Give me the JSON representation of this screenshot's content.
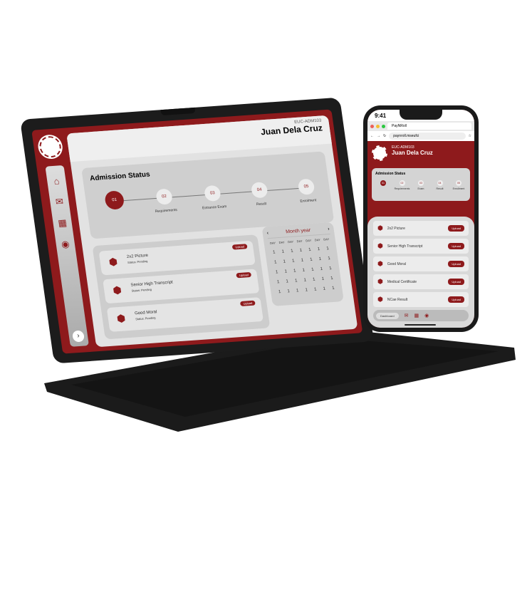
{
  "laptop": {
    "header": {
      "id": "EUC-ADM103",
      "name": "Juan Dela Cruz"
    },
    "sidebar": {
      "icons": [
        "home-icon",
        "mail-icon",
        "calendar-icon",
        "user-icon"
      ],
      "expand": "›"
    },
    "status": {
      "title": "Admission Status",
      "steps": [
        {
          "num": "01",
          "label": ""
        },
        {
          "num": "02",
          "label": "Requirements"
        },
        {
          "num": "03",
          "label": "Entrance Exam"
        },
        {
          "num": "04",
          "label": "Result"
        },
        {
          "num": "05",
          "label": "Enrolment"
        }
      ]
    },
    "documents": [
      {
        "title": "2x2 Picture",
        "status": "Status: Pending",
        "action": "Upload"
      },
      {
        "title": "Senior High Transcript",
        "status": "Status: Pending",
        "action": "Upload"
      },
      {
        "title": "Good Moral",
        "status": "Status: Pending",
        "action": "Upload"
      }
    ],
    "calendar": {
      "title": "Month year",
      "prev": "‹",
      "next": "›",
      "days": [
        "DAY",
        "DAY",
        "DAY",
        "DAY",
        "DAY",
        "DAY",
        "DAY"
      ],
      "dates": [
        "1",
        "1",
        "1",
        "1",
        "1",
        "1",
        "1",
        "1",
        "1",
        "1",
        "1",
        "1",
        "1",
        "1",
        "1",
        "1",
        "1",
        "1",
        "1",
        "1",
        "1",
        "1",
        "1",
        "1",
        "1",
        "1",
        "1",
        "1",
        "1",
        "1",
        "1",
        "1",
        "1",
        "1",
        "1"
      ]
    }
  },
  "phone": {
    "time": "9:41",
    "tab": "PayNRoll",
    "url": "paynroll.mseufci",
    "header": {
      "id": "EUC-ADM103",
      "name": "Juan Dela Cruz"
    },
    "status": {
      "title": "Admission Status",
      "steps": [
        {
          "num": "01",
          "label": ""
        },
        {
          "num": "02",
          "label": "Requirements"
        },
        {
          "num": "03",
          "label": "Exam"
        },
        {
          "num": "04",
          "label": "Result"
        },
        {
          "num": "05",
          "label": "Enrollment"
        }
      ]
    },
    "documents": [
      {
        "title": "2x2 Picture",
        "action": "Upload"
      },
      {
        "title": "Senior High Transcript",
        "action": "Upload"
      },
      {
        "title": "Good Moral",
        "action": "Upload"
      },
      {
        "title": "Medical Certificate",
        "action": "Upload"
      },
      {
        "title": "NCae Result",
        "action": "Upload"
      }
    ],
    "nav": {
      "dashboard": "Dashboard"
    }
  },
  "colors": {
    "brand": "#8e1a1c",
    "device": "#1a1a1a"
  }
}
